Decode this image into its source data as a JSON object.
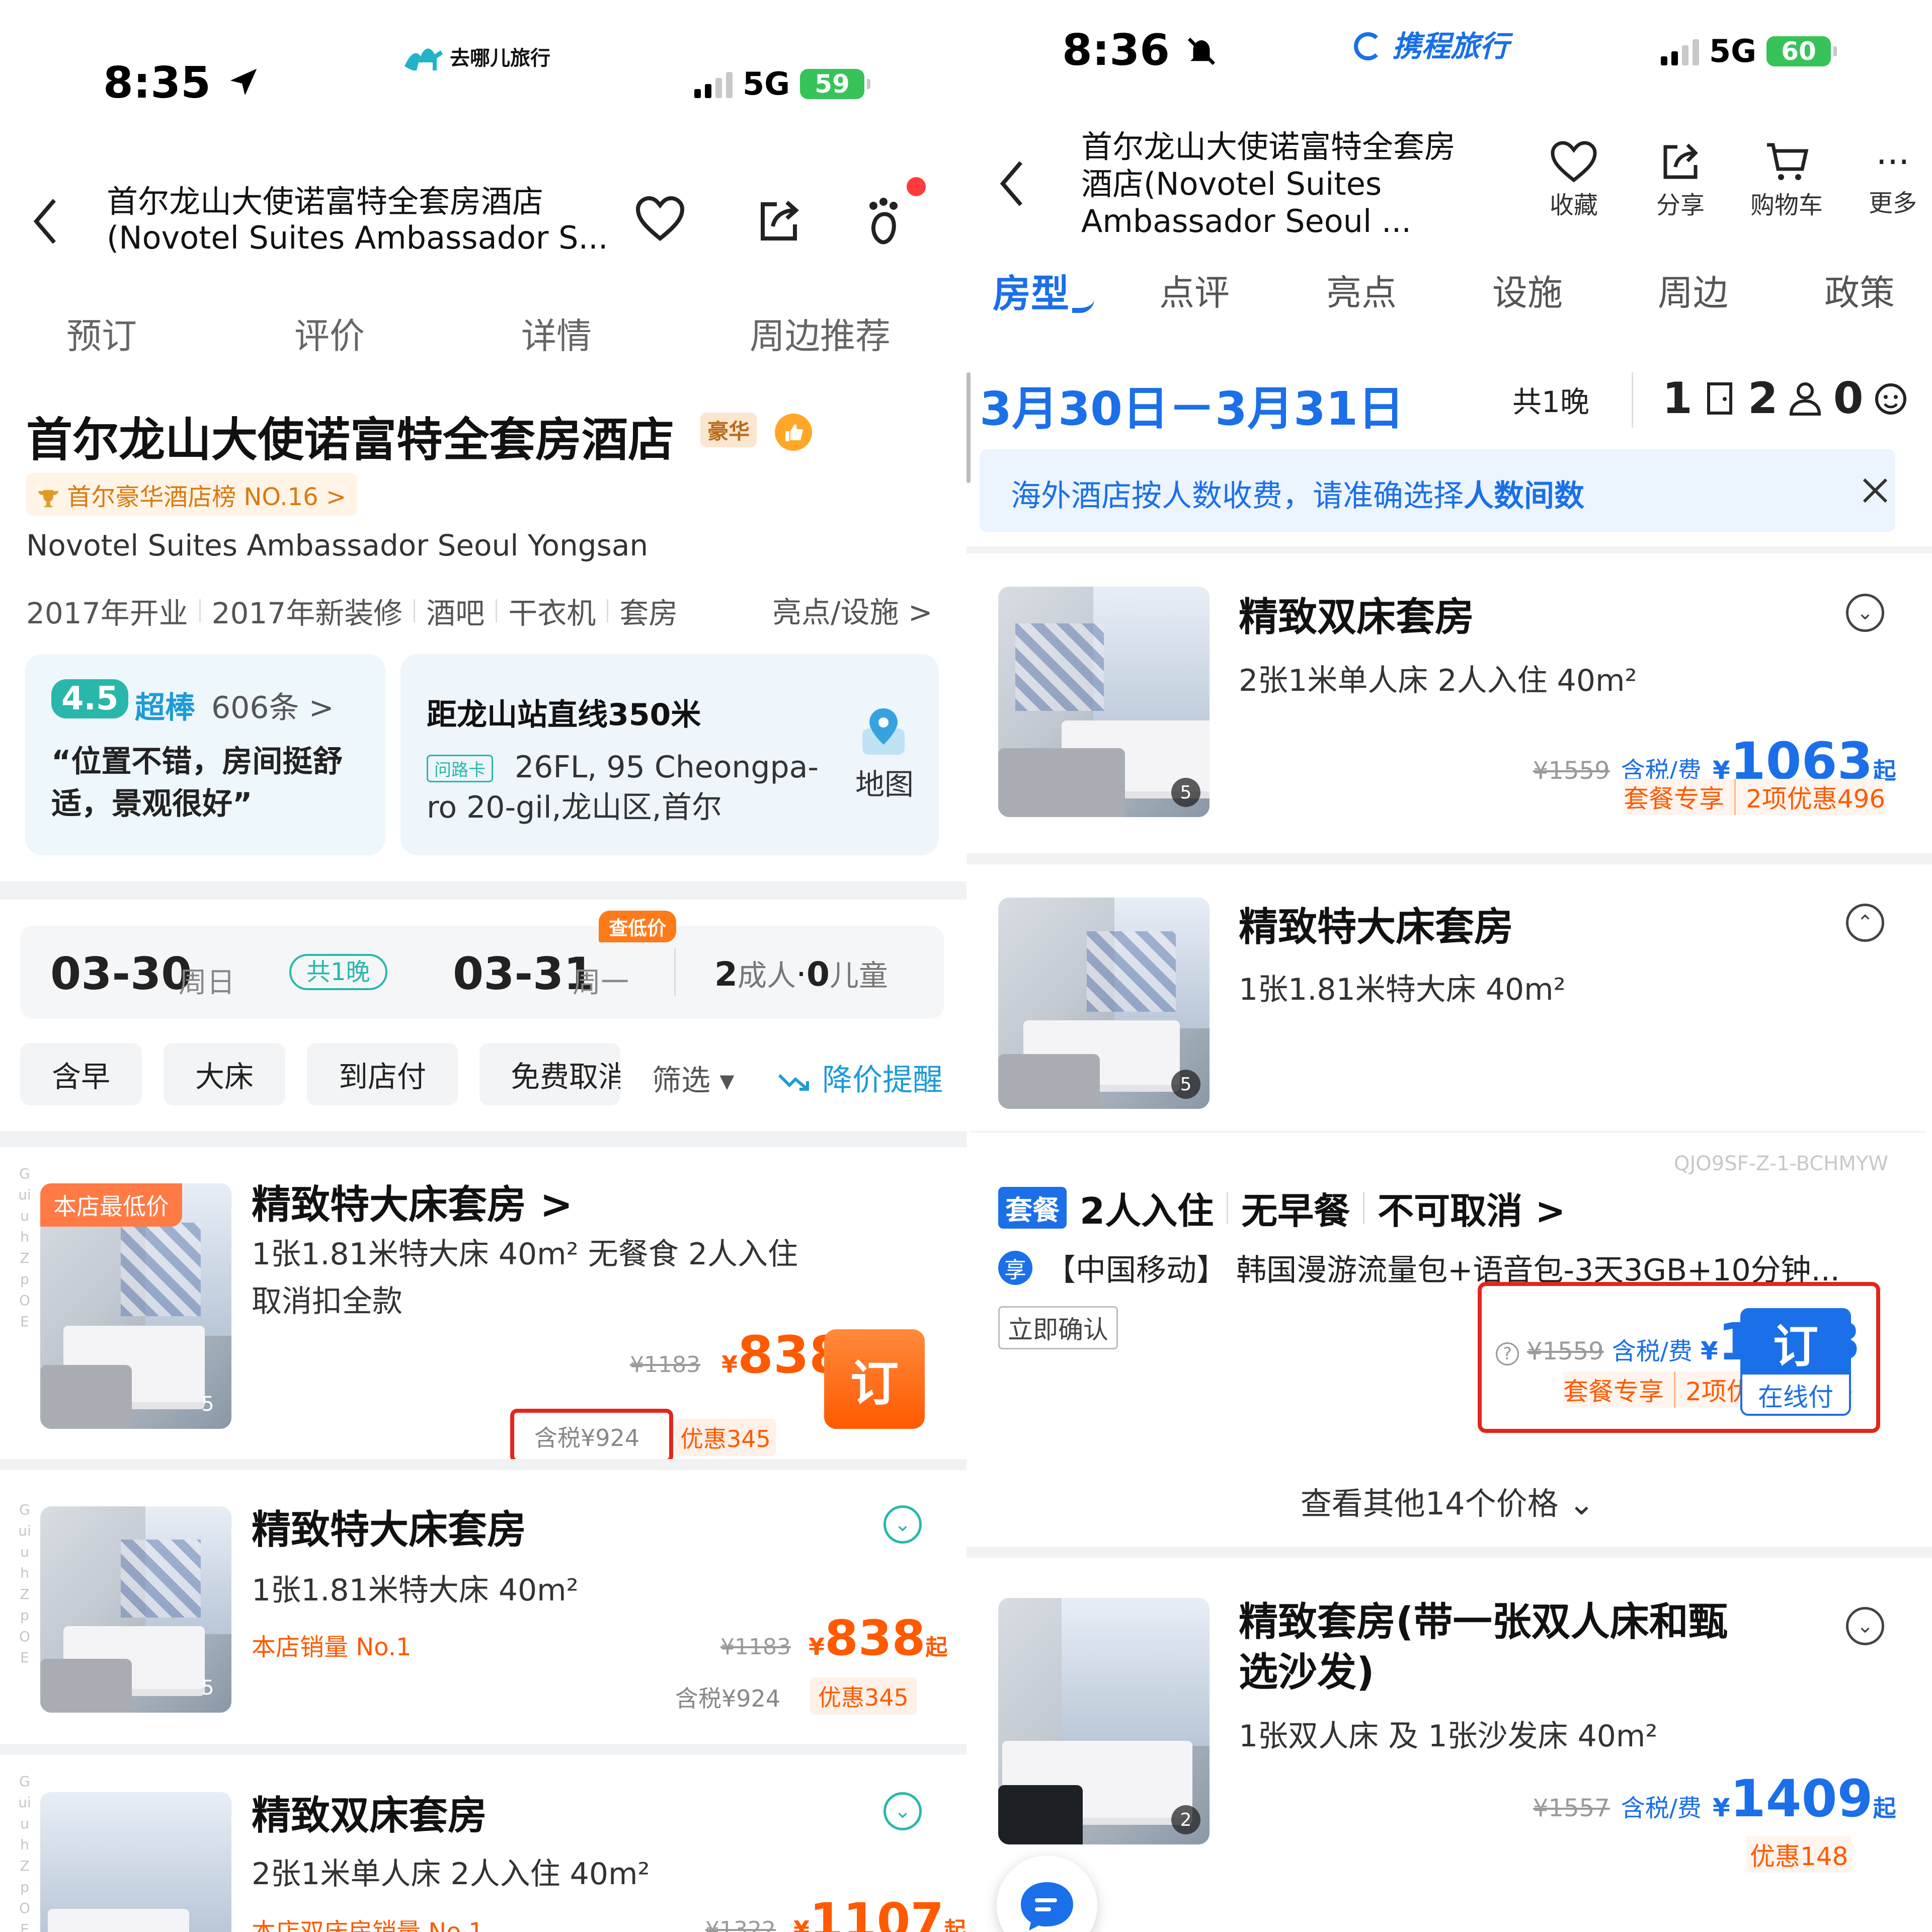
{
  "left": {
    "status": {
      "time": "8:35",
      "brand": "去哪儿旅行",
      "network": "5G",
      "battery": "59"
    },
    "header": {
      "title_line1": "首尔龙山大使诺富特全套房酒店",
      "title_line2": "(Novotel Suites Ambassador S..."
    },
    "tabs": [
      "预订",
      "评价",
      "详情",
      "周边推荐"
    ],
    "hotel": {
      "name": "首尔龙山大使诺富特全套房酒店",
      "level_badge": "豪华",
      "ranking": "首尔豪华酒店榜 NO.16 >",
      "english_name": "Novotel Suites Ambassador Seoul Yongsan",
      "tags": [
        "2017年开业",
        "2017年新装修",
        "酒吧",
        "干衣机",
        "套房"
      ],
      "highlights_link": "亮点/设施 >",
      "rating": {
        "score": "4.5",
        "label": "超棒",
        "count": "606条 >",
        "quote": "“位置不错，房间挺舒适，景观很好”"
      },
      "location": {
        "title": "距龙山站直线350米",
        "card_tag": "问路卡",
        "address": "26FL, 95 Cheongpa-ro 20-gil,龙山区,首尔",
        "map_label": "地图"
      }
    },
    "booking": {
      "checkin_date": "03-30",
      "checkin_day": "周日",
      "nights": "共1晚",
      "checkout_date": "03-31",
      "checkout_day": "周一",
      "low_price_badge": "查低价",
      "adults_num": "2",
      "adults_label": "成人",
      "dot": "·",
      "children_num": "0",
      "children_label": "儿童"
    },
    "filters": [
      "含早",
      "大床",
      "到店付",
      "免费取消",
      "筛选 ▾"
    ],
    "price_alert": "降价提醒",
    "rooms": [
      {
        "badge": "本店最低价",
        "title": "精致特大床套房 >",
        "specs": "1张1.81米特大床  40m²  无餐食  2人入住",
        "cancel": "取消扣全款",
        "photos": "5",
        "original": "¥1183",
        "currency": "¥",
        "price": "838",
        "tax_incl": "含税¥924",
        "discount": "优惠345",
        "book": "订"
      },
      {
        "title": "精致特大床套房",
        "specs": "1张1.81米特大床  40m²",
        "sales": "本店销量 No.1",
        "photos": "5",
        "original": "¥1183",
        "currency": "¥",
        "price": "838",
        "suffix": "起",
        "tax_incl": "含税¥924",
        "discount": "优惠345"
      },
      {
        "title": "精致双床套房",
        "specs": "2张1米单人床  2人入住  40m²",
        "sales": "本店双床房销量 No.1",
        "original": "¥1322",
        "currency": "¥",
        "price": "1107",
        "suffix": "起"
      }
    ],
    "side_code": "GuiuhZpOE"
  },
  "right": {
    "status": {
      "time": "8:36",
      "brand": "携程旅行",
      "network": "5G",
      "battery": "60"
    },
    "header": {
      "title": "首尔龙山大使诺富特全套房酒店(Novotel Suites Ambassador Seoul ..."
    },
    "actions": [
      "收藏",
      "分享",
      "购物车",
      "更多"
    ],
    "tabs": [
      "房型",
      "点评",
      "亮点",
      "设施",
      "周边",
      "政策"
    ],
    "dates": {
      "range": "3月30日－3月31日",
      "nights": "共1晚",
      "rooms": "1",
      "adults": "2",
      "children": "0"
    },
    "notice": {
      "text": "海外酒店按人数收费，请准确选择",
      "emphasis": "人数间数"
    },
    "rooms": [
      {
        "title": "精致双床套房",
        "specs": "2张1米单人床  2人入住  40m²",
        "photos": "5",
        "original": "¥1559",
        "tax_label": "含税/费",
        "currency": "¥",
        "price": "1063",
        "suffix": "起",
        "package": "套餐专享",
        "discount": "2项优惠496"
      },
      {
        "title": "精致特大床套房",
        "specs": "1张1.81米特大床  40m²",
        "photos": "5"
      }
    ],
    "package_offer": {
      "code": "QJO9SF-Z-1-BCHMYW",
      "tag": "套餐",
      "guests": "2人入住",
      "meal": "无早餐",
      "cancel": "不可取消 >",
      "perk_tag": "享",
      "perk": "【中国移动】 韩国漫游流量包+语音包-3天3GB+10分钟...",
      "confirm": "立即确认",
      "original": "¥1559",
      "tax_label": "含税/费",
      "currency": "¥",
      "price": "1063",
      "package": "套餐专享",
      "discount": "2项优惠496 >",
      "book": "订",
      "pay": "在线付"
    },
    "more_prices": "查看其他14个价格 ⌄",
    "room3": {
      "title_line1": "精致套房(带一张双人床和甄",
      "title_line2": "选沙发)",
      "specs": "1张双人床 及 1张沙发床  40m²",
      "photos": "2",
      "original": "¥1557",
      "tax_label": "含税/费",
      "currency": "¥",
      "price": "1409",
      "suffix": "起",
      "discount": "优惠148"
    }
  },
  "colors": {
    "qunar_orange": "#ff5a00",
    "qunar_teal": "#2ab7ab",
    "ctrip_blue": "#1b6fe8",
    "highlight_red": "#e3261b"
  }
}
